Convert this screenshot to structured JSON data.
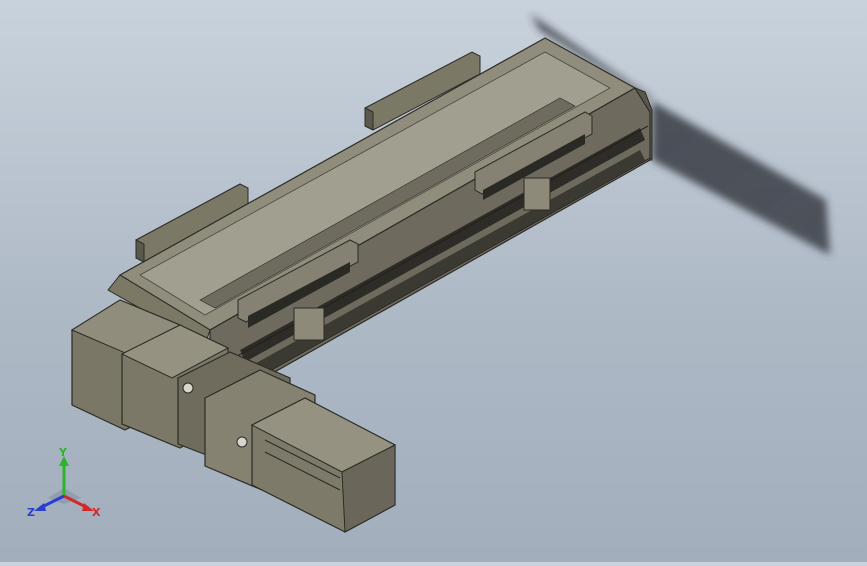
{
  "viewport": {
    "background_top": "#c9d2dc",
    "background_bottom": "#a2aebc",
    "model_color": "#6e6b5e",
    "shadow_color": "#3c4048"
  },
  "triad": {
    "x_label": "X",
    "y_label": "Y",
    "z_label": "Z",
    "x_color": "#d22a2a",
    "y_color": "#2bb52b",
    "z_color": "#2a3fd0"
  }
}
